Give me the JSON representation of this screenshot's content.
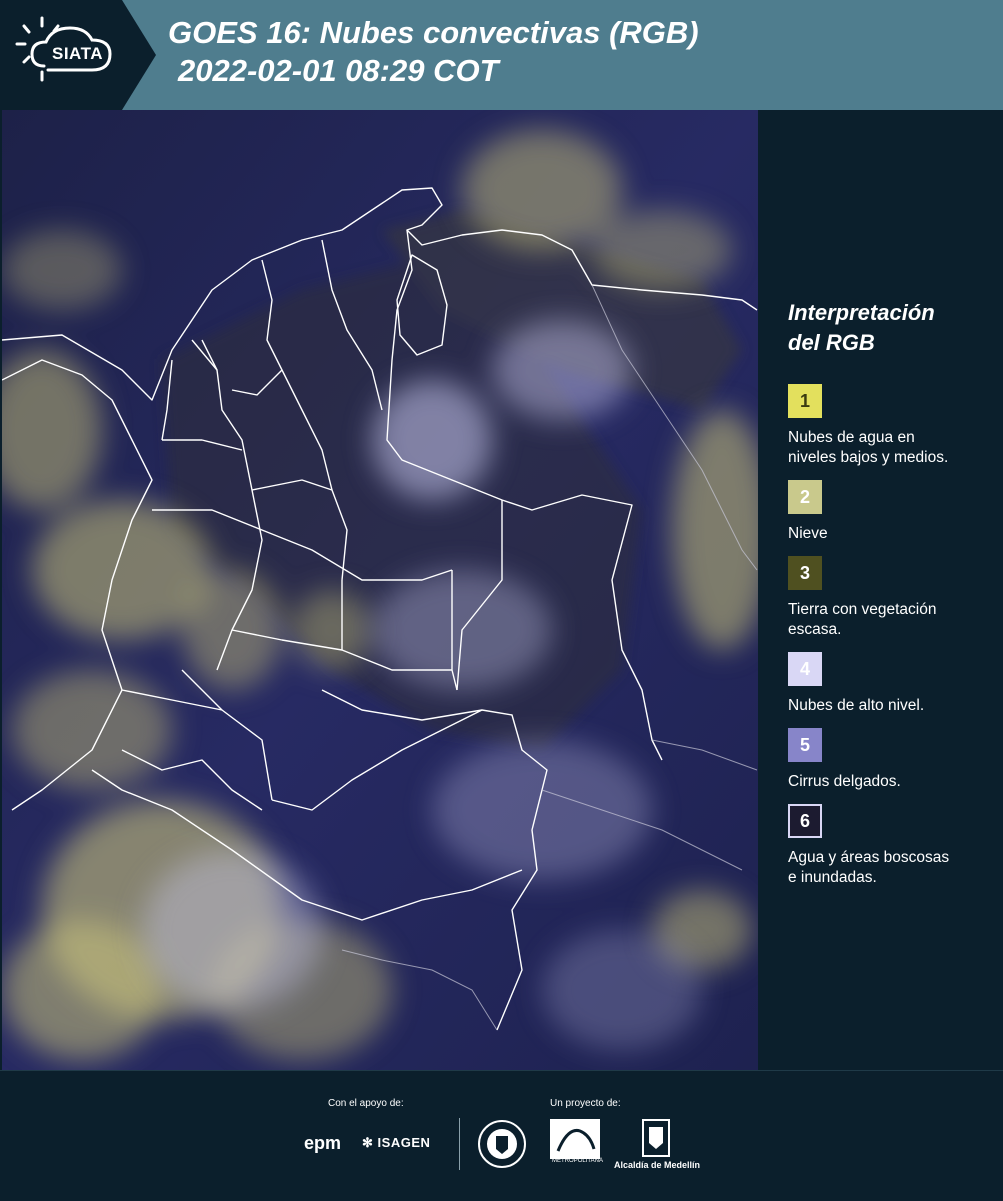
{
  "header": {
    "logo_text": "SIATA",
    "title_line1": "GOES 16: Nubes convectivas (RGB)",
    "title_line2": "2022-02-01 08:29 COT"
  },
  "legend": {
    "title_line1": "Interpretación",
    "title_line2": "del RGB",
    "items": [
      {
        "number": "1",
        "color": "#e3e05d",
        "label_line1": "Nubes de agua en",
        "label_line2": "niveles bajos y medios."
      },
      {
        "number": "2",
        "color": "#c9c98c",
        "label_line1": "Nieve",
        "label_line2": ""
      },
      {
        "number": "3",
        "color": "#4f5020",
        "label_line1": "Tierra con vegetación",
        "label_line2": "escasa."
      },
      {
        "number": "4",
        "color": "#d9d7f5",
        "label_line1": "Nubes de alto nivel.",
        "label_line2": ""
      },
      {
        "number": "5",
        "color": "#8785c9",
        "label_line1": "Cirrus delgados.",
        "label_line2": ""
      },
      {
        "number": "6",
        "color": "#1c1b30",
        "label_line1": "Agua y áreas boscosas",
        "label_line2": "e inundadas."
      }
    ]
  },
  "footer": {
    "support_caption": "Con el apoyo de:",
    "project_caption": "Un proyecto de:",
    "epm": "epm",
    "isagen": "ISAGEN",
    "area_text": "METROPOLITANA",
    "alcaldia": "Alcaldía de Medellín"
  },
  "colors": {
    "header_bg": "#4f7d8e",
    "panel_bg": "#0b1f2c",
    "map_base": "#1f2253",
    "cloud_yellow": "#c8c27a",
    "high_cloud": "#c9c8ee",
    "border_line": "#ffffff"
  }
}
